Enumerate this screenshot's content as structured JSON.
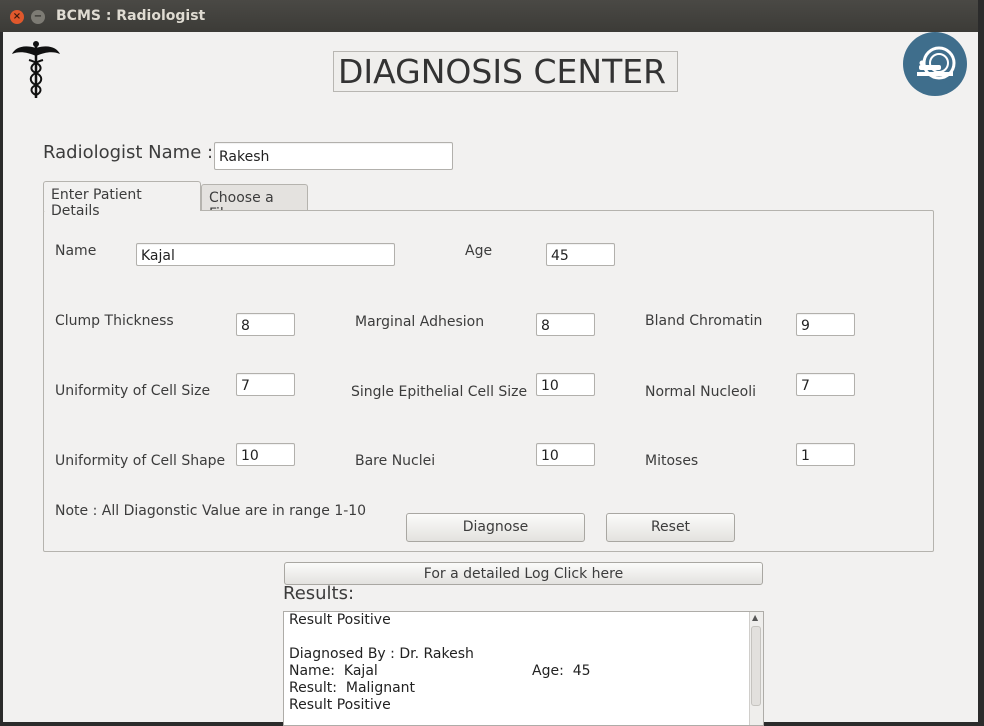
{
  "window": {
    "title": "BCMS : Radiologist",
    "close_glyph": "×",
    "minimize_glyph": "−"
  },
  "header": {
    "title": "DIAGNOSIS CENTER",
    "left_icon": "caduceus-icon",
    "right_icon": "mri-scanner-logo-icon",
    "logo_color": "#3f6e8c"
  },
  "radiologist": {
    "label": "Radiologist Name :",
    "value": "Rakesh"
  },
  "tabs": [
    {
      "label": "Enter Patient Details",
      "active": true
    },
    {
      "label": "Choose a File",
      "active": false
    }
  ],
  "patient": {
    "name_label": "Name",
    "name_value": "Kajal",
    "age_label": "Age",
    "age_value": "45"
  },
  "fields": {
    "clump_thickness": {
      "label": "Clump Thickness",
      "value": "8"
    },
    "marginal_adhesion": {
      "label": "Marginal Adhesion",
      "value": "8"
    },
    "bland_chromatin": {
      "label": "Bland Chromatin",
      "value": "9"
    },
    "uniformity_cell_size": {
      "label": "Uniformity of Cell Size",
      "value": "7"
    },
    "single_epithelial": {
      "label": "Single Epithelial Cell Size",
      "value": "10"
    },
    "normal_nucleoli": {
      "label": "Normal Nucleoli",
      "value": "7"
    },
    "uniformity_cell_shape": {
      "label": "Uniformity of Cell Shape",
      "value": "10"
    },
    "bare_nuclei": {
      "label": "Bare Nuclei",
      "value": "10"
    },
    "mitoses": {
      "label": "Mitoses",
      "value": "1"
    }
  },
  "note": "Note : All Diagonstic Value are in range 1-10",
  "buttons": {
    "diagnose": "Diagnose",
    "reset": "Reset",
    "log": "For a detailed Log Click here"
  },
  "results": {
    "heading": "Results:",
    "line1": "Result Positive",
    "line2": "",
    "line3": "Diagnosed By : Dr. Rakesh",
    "name_label": "Name:  Kajal",
    "age_label": "Age:  45",
    "line5": "Result:  Malignant",
    "line6": "Result Positive"
  }
}
